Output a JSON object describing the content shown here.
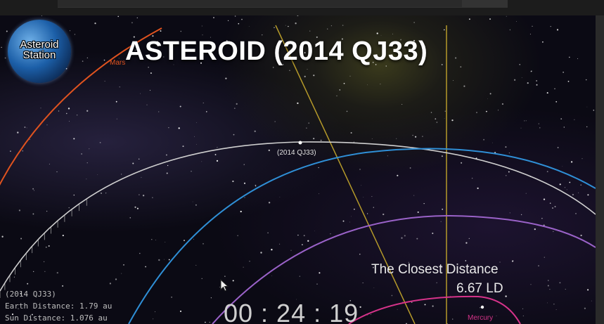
{
  "title": "ASTEROID (2014 QJ33)",
  "logo": {
    "line1": "Asteroid",
    "line2": "Station"
  },
  "labels": {
    "mars": "Mars",
    "asteroid": "(2014 QJ33)",
    "mercury": "Mercury"
  },
  "closest": {
    "title": "The Closest Distance",
    "value": "6.67 LD"
  },
  "info": {
    "name": "(2014 QJ33)",
    "earth_distance": "Earth Distance: 1.79 au",
    "sun_distance": "Sun Distance: 1.076 au"
  },
  "timer": "00 : 24 : 19",
  "colors": {
    "mars_orbit": "#e0531f",
    "asteroid_orbit": "#cfcfcf",
    "earth_orbit": "#2f8fd6",
    "venus_orbit": "#9a62c8",
    "mercury_orbit": "#d6338a",
    "guide_line": "#b59a2a"
  }
}
